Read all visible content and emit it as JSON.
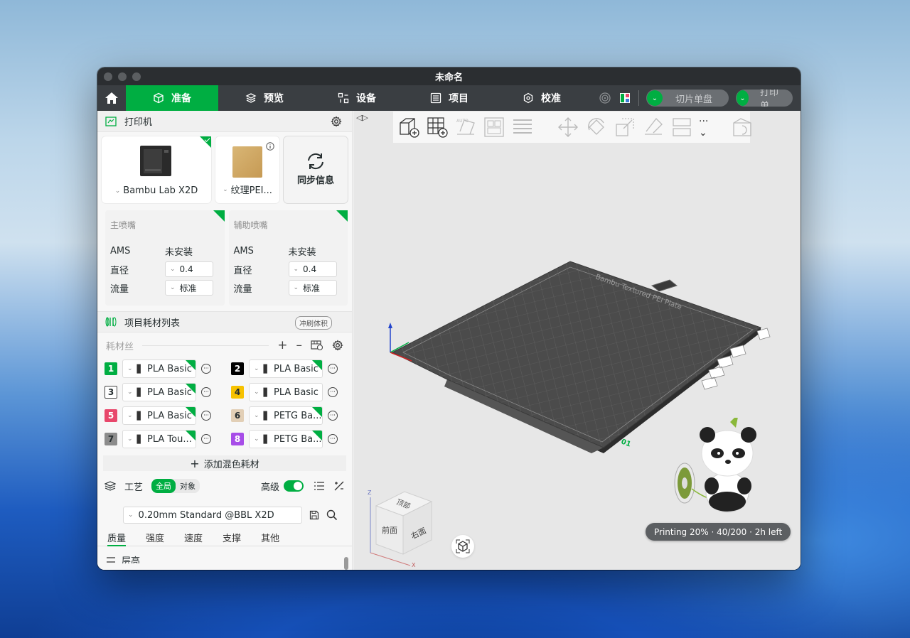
{
  "window": {
    "title": "未命名"
  },
  "nav": {
    "tabs": [
      {
        "label": "准备",
        "icon": "cube-icon",
        "active": true
      },
      {
        "label": "预览",
        "icon": "layers-icon",
        "active": false
      },
      {
        "label": "设备",
        "icon": "device-icon",
        "active": false
      },
      {
        "label": "项目",
        "icon": "list-icon",
        "active": false
      },
      {
        "label": "校准",
        "icon": "calibrate-icon",
        "active": false
      }
    ],
    "slice_label": "切片单盘",
    "print_label": "打印单"
  },
  "printer": {
    "section_title": "打印机",
    "model": "Bambu Lab X2D",
    "plate": "纹理PEI...",
    "sync_label": "同步信息"
  },
  "nozzles": [
    {
      "title": "主喷嘴",
      "ams_label": "AMS",
      "ams_value": "未安装",
      "diameter_label": "直径",
      "diameter": "0.4",
      "flow_label": "流量",
      "flow": "标准"
    },
    {
      "title": "辅助喷嘴",
      "ams_label": "AMS",
      "ams_value": "未安装",
      "diameter_label": "直径",
      "diameter": "0.4",
      "flow_label": "流量",
      "flow": "标准"
    }
  ],
  "filament": {
    "section_title": "项目耗材列表",
    "flush_label": "冲刷体积",
    "sub_title": "耗材丝",
    "items": [
      {
        "num": "1",
        "name": "PLA Basic",
        "color": "#00ae42",
        "text_color": "#ffffff"
      },
      {
        "num": "2",
        "name": "PLA Basic",
        "color": "#000000",
        "text_color": "#ffffff"
      },
      {
        "num": "3",
        "name": "PLA Basic",
        "color": "#ffffff",
        "text_color": "#262e30"
      },
      {
        "num": "4",
        "name": "PLA Basic",
        "color": "#f7c200",
        "text_color": "#262e30"
      },
      {
        "num": "5",
        "name": "PLA Basic",
        "color": "#e8476b",
        "text_color": "#ffffff"
      },
      {
        "num": "6",
        "name": "PETG Ba...",
        "color": "#e2cfb6",
        "text_color": "#262e30"
      },
      {
        "num": "7",
        "name": "PLA Tou...",
        "color": "#8c8c8c",
        "text_color": "#262e30"
      },
      {
        "num": "8",
        "name": "PETG Ba...",
        "color": "#a74de8",
        "text_color": "#ffffff"
      }
    ],
    "add_mix_label": "添加混色耗材"
  },
  "process": {
    "section_title": "工艺",
    "seg_global": "全局",
    "seg_object": "对象",
    "advanced_label": "高级",
    "preset": "0.20mm Standard @BBL X2D",
    "tabs": [
      "质量",
      "强度",
      "速度",
      "支撑",
      "其他"
    ],
    "partial_row": "层高"
  },
  "viewport": {
    "status": "Printing 20% · 40/200 · 2h left",
    "plate_text": "Bambu Textured PEI Plate",
    "plate_number": "01",
    "cube_top": "顶部",
    "cube_front": "前面",
    "cube_right": "右面",
    "axis_x": "X",
    "axis_z": "Z"
  },
  "colors": {
    "accent": "#00ae42",
    "nav_bg": "#3a3e42",
    "titlebar_bg": "#2b2e31"
  }
}
